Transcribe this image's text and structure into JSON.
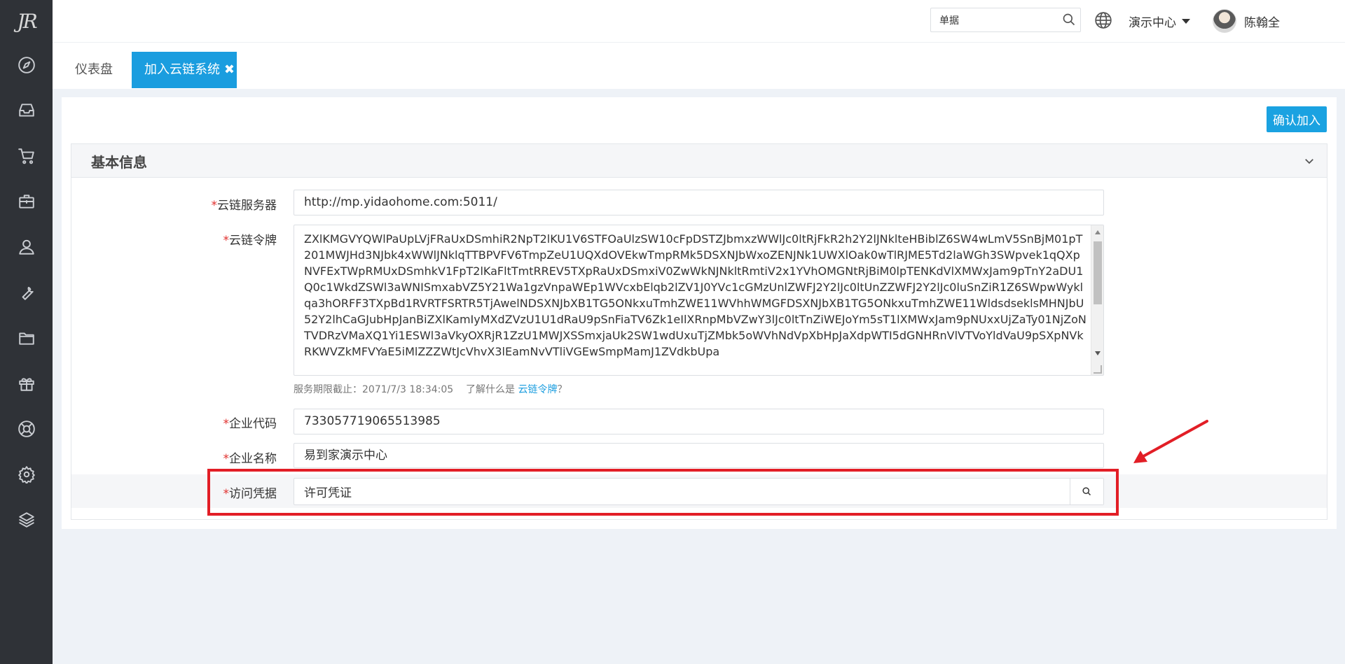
{
  "sidebar": {
    "logo_text": "JR",
    "items": [
      {
        "icon": "compass-icon"
      },
      {
        "icon": "inbox-icon"
      },
      {
        "icon": "cart-icon"
      },
      {
        "icon": "briefcase-icon"
      },
      {
        "icon": "user-icon"
      },
      {
        "icon": "wrench-icon"
      },
      {
        "icon": "folder-icon"
      },
      {
        "icon": "gift-icon"
      },
      {
        "icon": "lifebuoy-icon"
      },
      {
        "icon": "gear-icon"
      },
      {
        "icon": "layers-icon"
      }
    ]
  },
  "header": {
    "search_value": "单据",
    "org_label": "演示中心",
    "user_name": "陈翰全",
    "help_glyph": "?"
  },
  "tabs": [
    {
      "label": "仪表盘",
      "active": false
    },
    {
      "label": "加入云链系统",
      "active": true,
      "close_glyph": "✖"
    }
  ],
  "toolbar": {
    "confirm_label": "确认加入"
  },
  "panel": {
    "title": "基本信息"
  },
  "form": {
    "required_mark": "*",
    "server_label": "云链服务器",
    "server_value": "http://mp.yidaohome.com:5011/",
    "token_label": "云链令牌",
    "token_value": "ZXlKMGVYQWlPaUpLVjFRaUxDSmhiR2NpT2lKU1V6STFOaUlzSW10cFpDSTZJbmxzWWlJc0ltRjFkR2h2Y2lJNklteHBiblZ6SW4wLmV5SnBjM01pT201MWJHd3NJbk4xWWlJNklqTTBPVFV6TmpZeU1UQXdOVEkwTmpRMk5DSXNJbWxoZENJNk1UWXlOak0wTlRJME5Td2laWGh3SWpvek1qQXpNVFExTWpRMUxDSmhkV1FpT2lKaFltTmtRREV5TXpRaUxDSmxiV0ZwWkNJNkltRmtiV2x1YVhOMGNtRjBiM0lpTENKdVlXMWxJam9pTnY2aDU1Q0c1WkdZSWl3aWNISmxabVZ5Y21Wa1gzVnpaWEp1WVcxbElqb2lZV1J0YVc1cGMzUnlZWFJ2Y2lJc0ltUnZZWFJ2Y2lJc0luSnZiR1Z6SWpwWyklqa3hORFF3TXpBd1RVRTFSRTR5TjAwelNDSXNJbXB1TG5ONkxuTmhZWE11WVhhWMGFDSXNJbXB1TG5ONkxuTmhZWE11WldsdseklsMHNJbU52Y2lhCaGJubHpJanBiZXlKamIyMXdZVzU1U1dRaU9pSnFiaTV6Zk1eIlXRnpMbVZwY3lJc0ltTnZiWEJoYm5sT1lXMWxJam9pNUxxUjZaTy01NjZoNTVDRzVMaXQ1Yi1ESWl3aVkyOXRjR1ZzU1MWJXSSmxjaUk2SW1wdUxuTjZMbk5oWVhNdVpXbHpJaXdpWTI5dGNHRnVlVTVoYldVaU9pSXpNVkRKWVZkMFVYaE5iMlZZZWtJcVhvX3lEamNvVTliVGEwSmpMamJ1ZVdkbUpa",
    "token_expiry_prefix": "服务期限截止：",
    "token_expiry": "2071/7/3 18:34:05",
    "token_help_prefix": "了解什么是",
    "token_help_link": "云链令牌",
    "token_help_suffix": "？",
    "code_label": "企业代码",
    "code_value": "733057719065513985",
    "name_label": "企业名称",
    "name_value": "易到家演示中心",
    "credential_label": "访问凭据",
    "credential_value": "许可凭证"
  },
  "colors": {
    "accent": "#1a9ddf",
    "sidebar_bg": "#2f3237",
    "annotation": "#e21e26",
    "required": "#e0312f"
  }
}
